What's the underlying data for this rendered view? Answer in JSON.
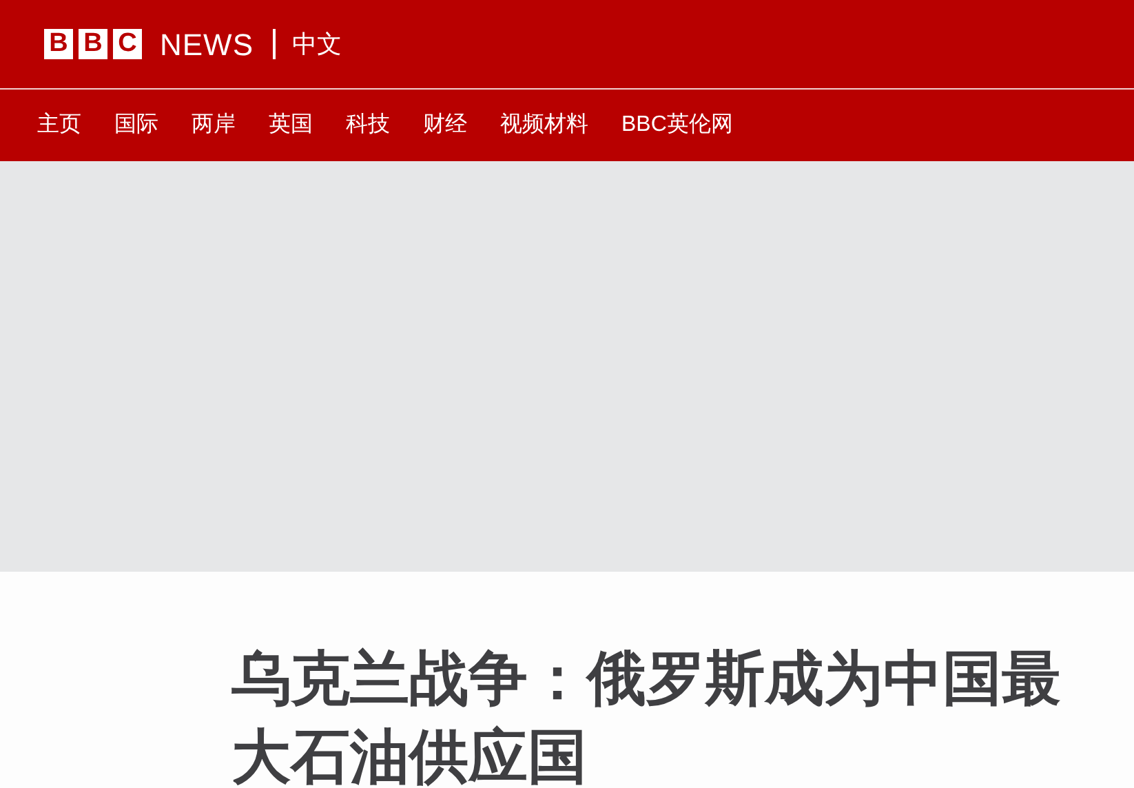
{
  "header": {
    "logo_letters": [
      "B",
      "B",
      "C"
    ],
    "brand": "NEWS",
    "edition": "中文"
  },
  "nav": [
    {
      "label": "主页"
    },
    {
      "label": "国际"
    },
    {
      "label": "两岸"
    },
    {
      "label": "英国"
    },
    {
      "label": "科技"
    },
    {
      "label": "财经"
    },
    {
      "label": "视频材料"
    },
    {
      "label": "BBC英伦网"
    }
  ],
  "article": {
    "headline": "乌克兰战争：俄罗斯成为中国最大石油供应国"
  }
}
